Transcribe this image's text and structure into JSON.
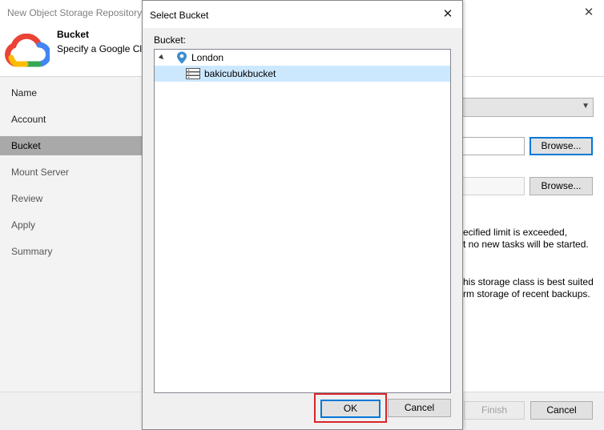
{
  "wizard": {
    "title": "New Object Storage Repository",
    "header": {
      "title": "Bucket",
      "subtitle": "Specify a Google Cloud"
    },
    "steps": [
      {
        "label": "Name",
        "state": "done"
      },
      {
        "label": "Account",
        "state": "done"
      },
      {
        "label": "Bucket",
        "state": "active"
      },
      {
        "label": "Mount Server",
        "state": "pending"
      },
      {
        "label": "Review",
        "state": "pending"
      },
      {
        "label": "Apply",
        "state": "pending"
      },
      {
        "label": "Summary",
        "state": "pending"
      }
    ],
    "browse_label_1": "Browse...",
    "browse_label_2": "Browse...",
    "partial_text_1": "ecified limit is exceeded,",
    "partial_text_2": "t no new tasks will be started.",
    "partial_text_3": "his storage class is best suited",
    "partial_text_4": "rm storage of recent backups.",
    "finish_label": "Finish",
    "cancel_label": "Cancel"
  },
  "dialog": {
    "title": "Select Bucket",
    "label": "Bucket:",
    "tree": {
      "region": "London",
      "bucket": "bakicubukbucket"
    },
    "ok_label": "OK",
    "cancel_label": "Cancel"
  },
  "colors": {
    "selection": "#cce8ff",
    "active_step": "#a9a9a9",
    "focus_border": "#0078d7",
    "annotation_red": "#d9252a",
    "pin_blue": "#3b8ed0"
  }
}
